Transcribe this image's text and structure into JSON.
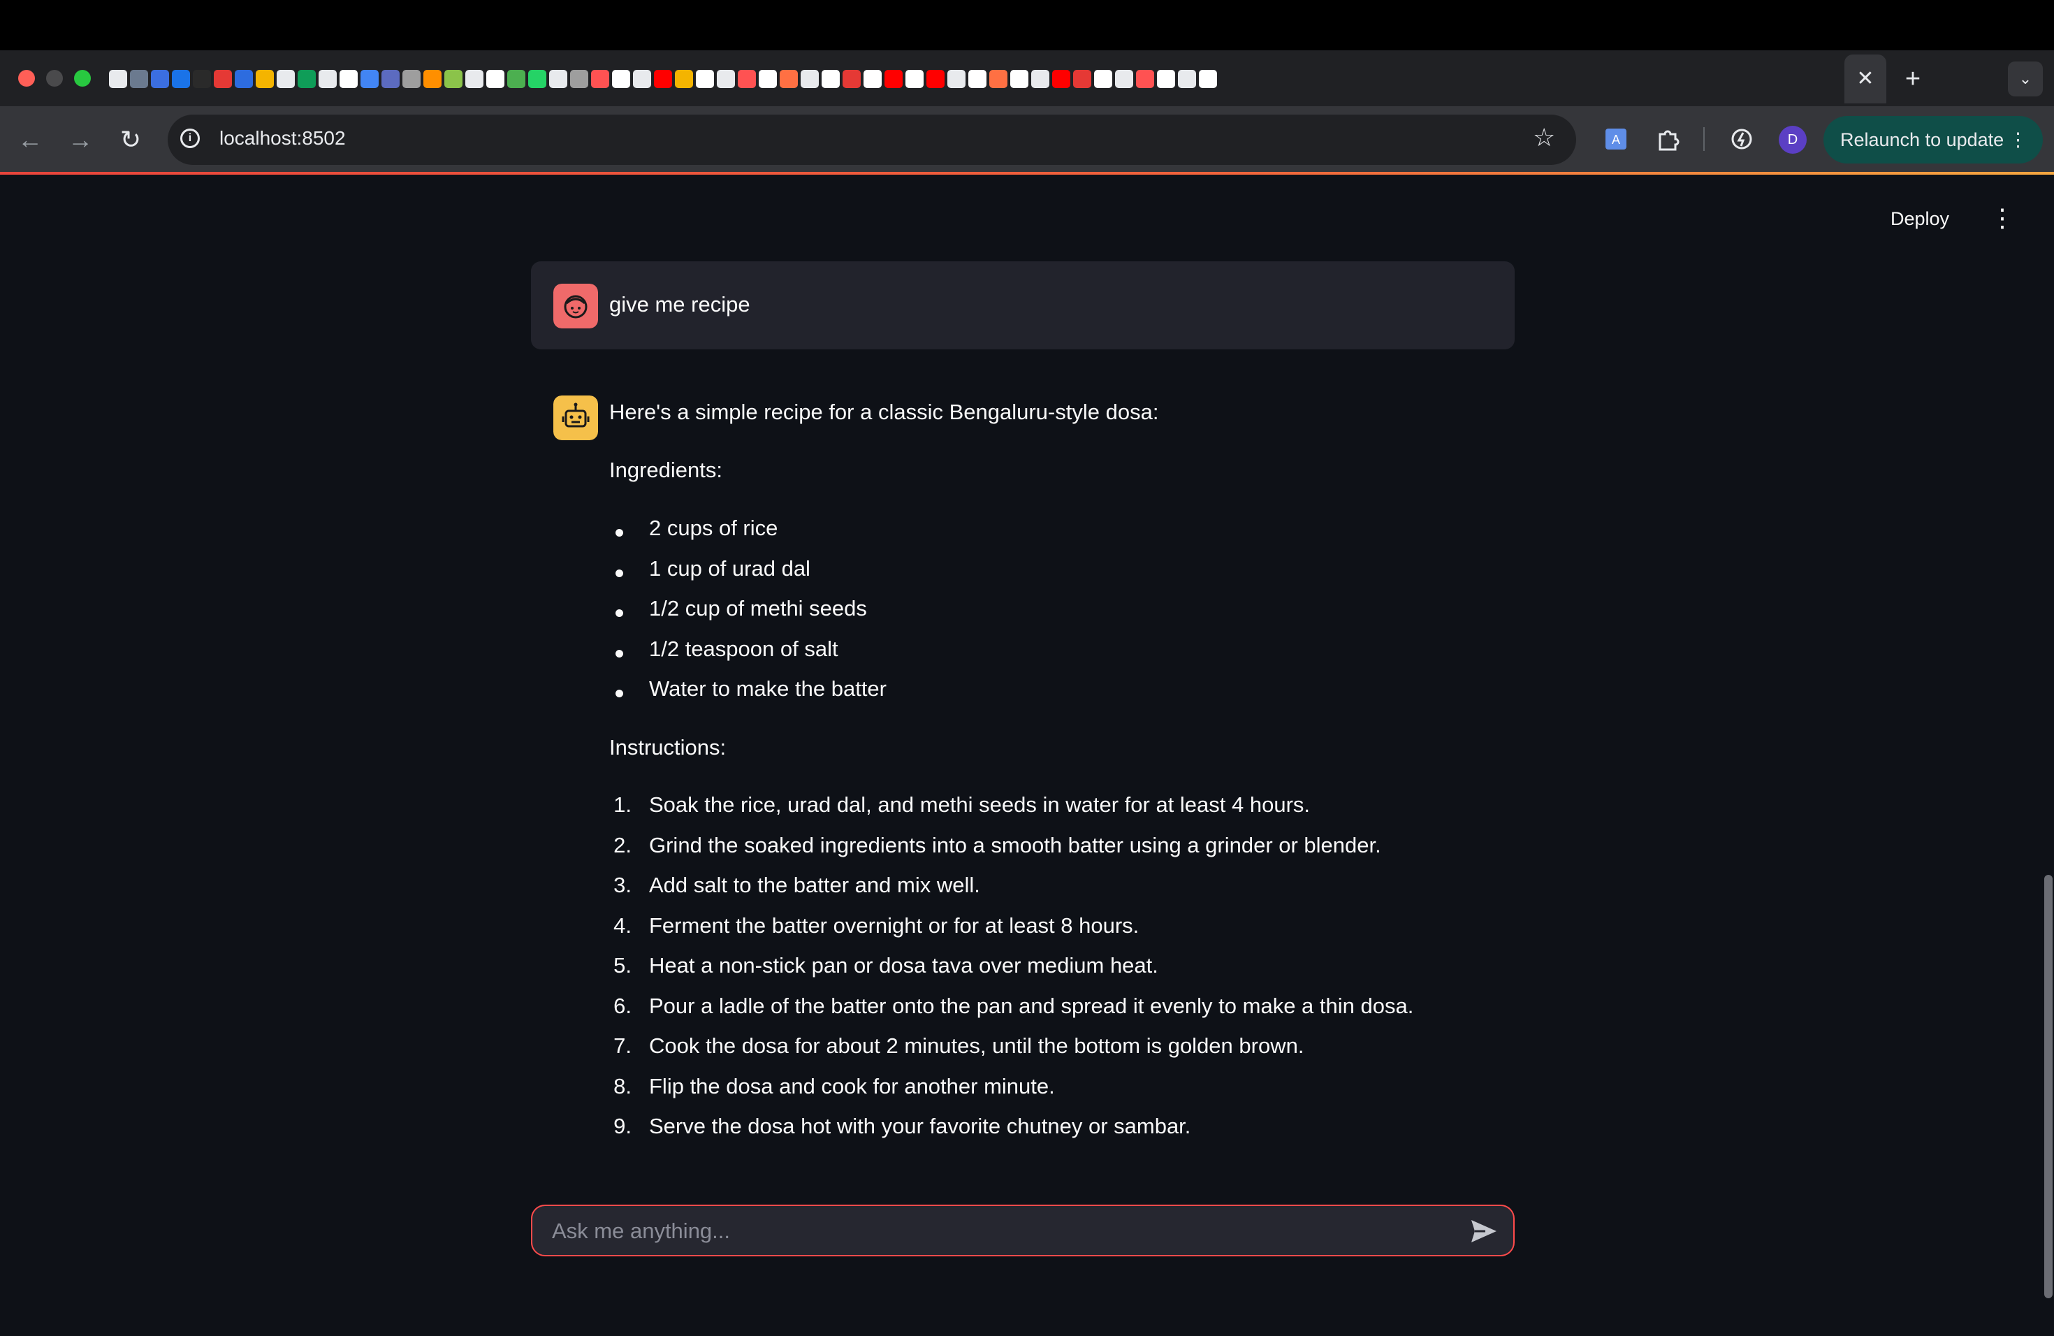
{
  "browser": {
    "url": "localhost:8502",
    "profile_initial": "D",
    "relaunch_label": "Relaunch to update",
    "tab_close_glyph": "✕",
    "new_tab_glyph": "+",
    "colors": {
      "titlebar": "#000000",
      "tabstrip": "#202124",
      "toolbar": "#35363a",
      "omnibox": "#202124",
      "relaunch_bg": "#0f4e48"
    }
  },
  "app": {
    "deploy_label": "Deploy",
    "accent": "#ff4b4b",
    "background": "#0e1117"
  },
  "chat": {
    "user_message": "give me recipe",
    "assistant": {
      "intro": "Here's a simple recipe for a classic Bengaluru-style dosa:",
      "ingredients_heading": "Ingredients:",
      "ingredients": [
        "2 cups of rice",
        "1 cup of urad dal",
        "1/2 cup of methi seeds",
        "1/2 teaspoon of salt",
        "Water to make the batter"
      ],
      "instructions_heading": "Instructions:",
      "instructions": [
        "Soak the rice, urad dal, and methi seeds in water for at least 4 hours.",
        "Grind the soaked ingredients into a smooth batter using a grinder or blender.",
        "Add salt to the batter and mix well.",
        "Ferment the batter overnight or for at least 8 hours.",
        "Heat a non-stick pan or dosa tava over medium heat.",
        "Pour a ladle of the batter onto the pan and spread it evenly to make a thin dosa.",
        "Cook the dosa for about 2 minutes, until the bottom is golden brown.",
        "Flip the dosa and cook for another minute.",
        "Serve the dosa hot with your favorite chutney or sambar."
      ]
    },
    "input_placeholder": "Ask me anything..."
  },
  "icons": {
    "user_avatar": "face-icon",
    "assistant_avatar": "robot-icon",
    "send": "send-icon",
    "user_avatar_color": "#f06a6a",
    "assistant_avatar_color": "#f5c04a"
  }
}
